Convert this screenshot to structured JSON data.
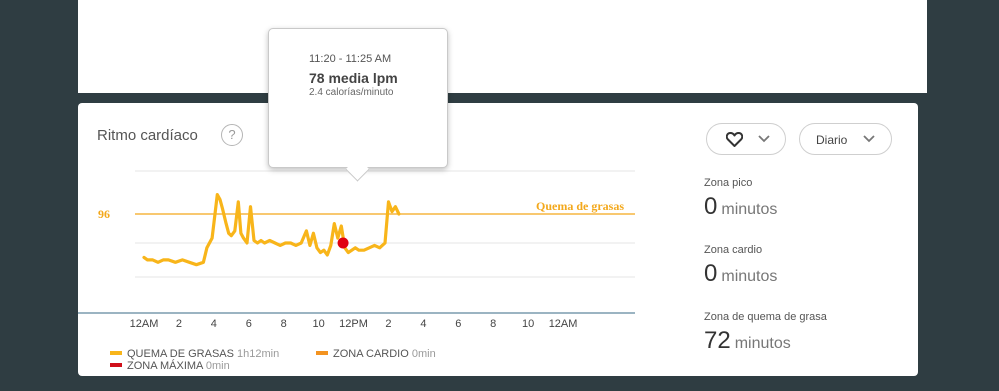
{
  "colors": {
    "fat_burn": "#f8b51a",
    "cardio": "#f39320",
    "peak": "#d0101a",
    "line": "#f8b51a",
    "threshold_label": "#f3a81b",
    "marker": "#e00010"
  },
  "card": {
    "title": "Ritmo cardíaco",
    "help_glyph": "?"
  },
  "controls": {
    "metric_icon": "heart-icon",
    "range_label": "Diario"
  },
  "tooltip": {
    "time": "11:20 - 11:25 AM",
    "value": "78 media lpm",
    "calories": "2.4 calorías/minuto"
  },
  "legend": [
    {
      "label": "QUEMA DE GRASAS",
      "duration": "1h12min",
      "color": "#f8b51a"
    },
    {
      "label": "ZONA CARDIO",
      "duration": "0min",
      "color": "#f39320"
    },
    {
      "label": "ZONA MÁXIMA",
      "duration": "0min",
      "color": "#d0101a"
    }
  ],
  "zones": [
    {
      "label": "Zona pico",
      "value": "0",
      "unit": "minutos"
    },
    {
      "label": "Zona cardio",
      "value": "0",
      "unit": "minutos"
    },
    {
      "label": "Zona de quema de grasa",
      "value": "72",
      "unit": "minutos"
    }
  ],
  "chart_data": {
    "type": "line",
    "x_ticks": [
      "12AM",
      "2",
      "4",
      "6",
      "8",
      "10",
      "12PM",
      "2",
      "4",
      "6",
      "8",
      "10",
      "12AM"
    ],
    "threshold": {
      "value": 96,
      "label": "Quema de grasas",
      "tick_label": "96"
    },
    "ylim": [
      55,
      120
    ],
    "x_unit": "hours",
    "xlim": [
      0,
      26
    ],
    "series": [
      {
        "x": [
          0,
          0.2,
          0.5,
          0.8,
          1.1,
          1.4,
          1.8,
          2.2,
          2.6,
          3.0,
          3.4,
          3.6,
          3.9,
          4.05,
          4.2,
          4.35,
          4.5,
          4.7,
          4.85,
          5.0,
          5.2,
          5.4,
          5.55,
          5.7,
          5.9,
          6.1,
          6.3,
          6.5,
          6.7,
          6.9,
          7.2,
          7.5,
          7.8,
          8.1,
          8.4,
          8.7,
          9.0,
          9.3,
          9.5,
          9.7,
          9.9,
          10.1,
          10.3,
          10.5,
          10.7,
          10.9,
          11.1,
          11.3,
          11.5,
          11.7,
          11.9,
          12.1,
          12.3,
          12.6,
          12.9,
          13.2,
          13.5,
          13.8,
          14.0,
          14.2,
          14.4,
          14.6
        ],
        "y": [
          78,
          77,
          77,
          76,
          77,
          77,
          76,
          77,
          76,
          75,
          76,
          82,
          86,
          95,
          104,
          102,
          98,
          92,
          88,
          87,
          89,
          101,
          88,
          86,
          84,
          99,
          85,
          84,
          85,
          84,
          85,
          84,
          83,
          84,
          84,
          83,
          84,
          89,
          83,
          88,
          82,
          80,
          81,
          79,
          83,
          92,
          86,
          91,
          82,
          80,
          81,
          82,
          81,
          81,
          82,
          83,
          82,
          84,
          101,
          97,
          99,
          96
        ]
      }
    ],
    "marker": {
      "x": 11.4,
      "y": 84
    },
    "grid": true
  }
}
